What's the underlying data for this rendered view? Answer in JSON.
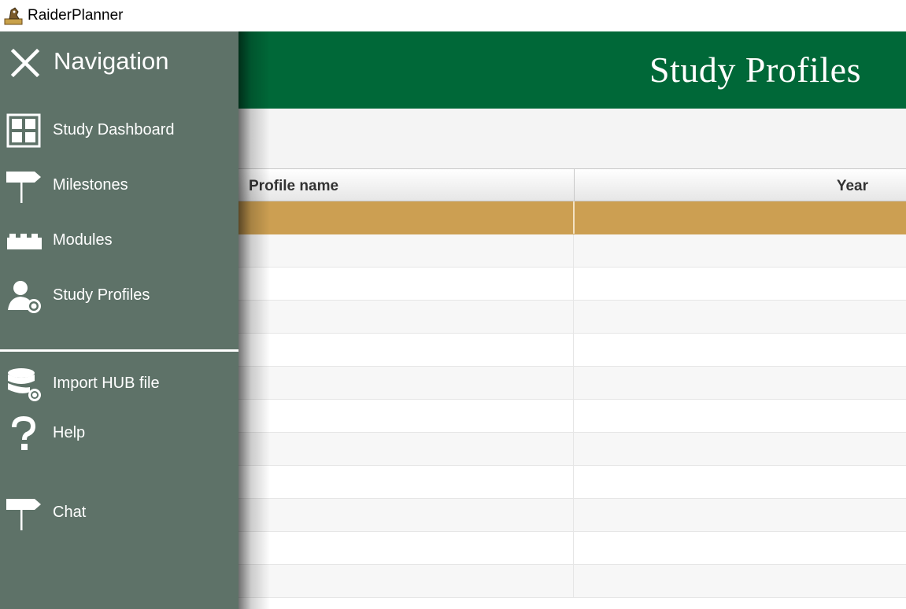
{
  "window": {
    "title": "RaiderPlanner",
    "app_icon": "raider-logo-icon"
  },
  "header": {
    "title": "Study Profiles",
    "color": "#006838"
  },
  "table": {
    "columns": [
      "Profile name",
      "Year"
    ],
    "selected_row_color": "#cc9f52",
    "rows": [
      {
        "name": "",
        "year": "",
        "selected": true
      },
      {
        "name": "",
        "year": ""
      },
      {
        "name": "",
        "year": ""
      },
      {
        "name": "",
        "year": ""
      },
      {
        "name": "",
        "year": ""
      },
      {
        "name": "",
        "year": ""
      },
      {
        "name": "",
        "year": ""
      },
      {
        "name": "",
        "year": ""
      },
      {
        "name": "",
        "year": ""
      },
      {
        "name": "",
        "year": ""
      },
      {
        "name": "",
        "year": ""
      },
      {
        "name": "",
        "year": ""
      }
    ]
  },
  "nav": {
    "title": "Navigation",
    "close_icon": "close-icon",
    "background": "#5e7268",
    "items": [
      {
        "label": "Study Dashboard",
        "icon": "dashboard-grid-icon"
      },
      {
        "label": "Milestones",
        "icon": "signpost-icon"
      },
      {
        "label": "Modules",
        "icon": "brick-icon"
      },
      {
        "label": "Study Profiles",
        "icon": "user-settings-icon"
      }
    ],
    "secondary_items": [
      {
        "label": "Import HUB file",
        "icon": "database-settings-icon"
      },
      {
        "label": "Help",
        "icon": "question-mark-icon"
      },
      {
        "label": "Chat",
        "icon": "signpost-icon"
      }
    ]
  }
}
